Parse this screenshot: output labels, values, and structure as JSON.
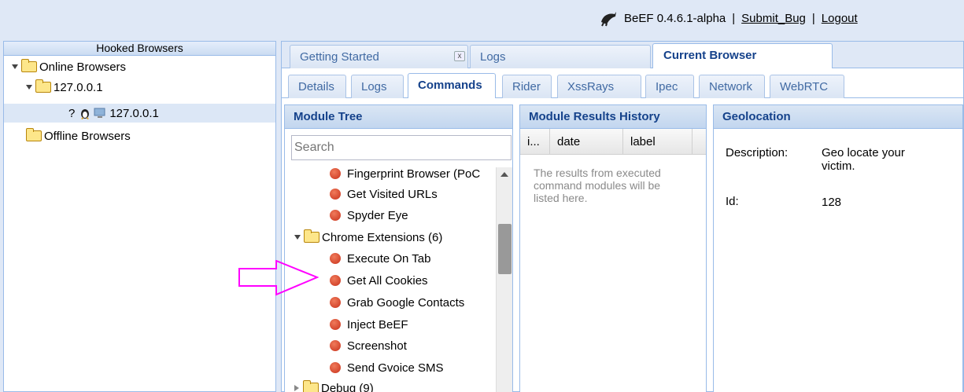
{
  "header": {
    "app_name": "BeEF",
    "version": "0.4.6.1-alpha",
    "separator": "|",
    "submit_bug": "Submit_Bug",
    "logout": "Logout"
  },
  "left_panel": {
    "title": "Hooked Browsers",
    "online": "Online Browsers",
    "host_group": "127.0.0.1",
    "browser_unknown_glyph": "?",
    "browser_entry": "127.0.0.1",
    "offline": "Offline Browsers"
  },
  "top_tabs": [
    "Getting Started",
    "Logs",
    "Current Browser"
  ],
  "top_tab_close": "x",
  "sub_tabs": [
    "Details",
    "Logs",
    "Commands",
    "Rider",
    "XssRays",
    "Ipec",
    "Network",
    "WebRTC"
  ],
  "module_tree": {
    "title": "Module Tree",
    "search_placeholder": "Search",
    "items": [
      "Fingerprint Browser (PoC",
      "Get Visited URLs",
      "Spyder Eye",
      "Chrome Extensions (6)",
      "Execute On Tab",
      "Get All Cookies",
      "Grab Google Contacts",
      "Inject BeEF",
      "Screenshot",
      "Send Gvoice SMS",
      "Debug (9)"
    ]
  },
  "results_history": {
    "title": "Module Results History",
    "columns": [
      "i...",
      "date",
      "label"
    ],
    "empty_text": "The results from executed command modules will be listed here."
  },
  "geolocation": {
    "title": "Geolocation",
    "description_label": "Description:",
    "description_value": "Geo locate your victim.",
    "id_label": "Id:",
    "id_value": "128"
  },
  "colors": {
    "panel_header_text": "#15428b",
    "module_dot": "#d9462a",
    "annotation_arrow": "#ff00ff"
  },
  "icons": [
    "beef-logo-icon",
    "folder-icon",
    "linux-tux-icon",
    "computer-icon",
    "module-dot-icon",
    "pink-arrow-annotation"
  ]
}
